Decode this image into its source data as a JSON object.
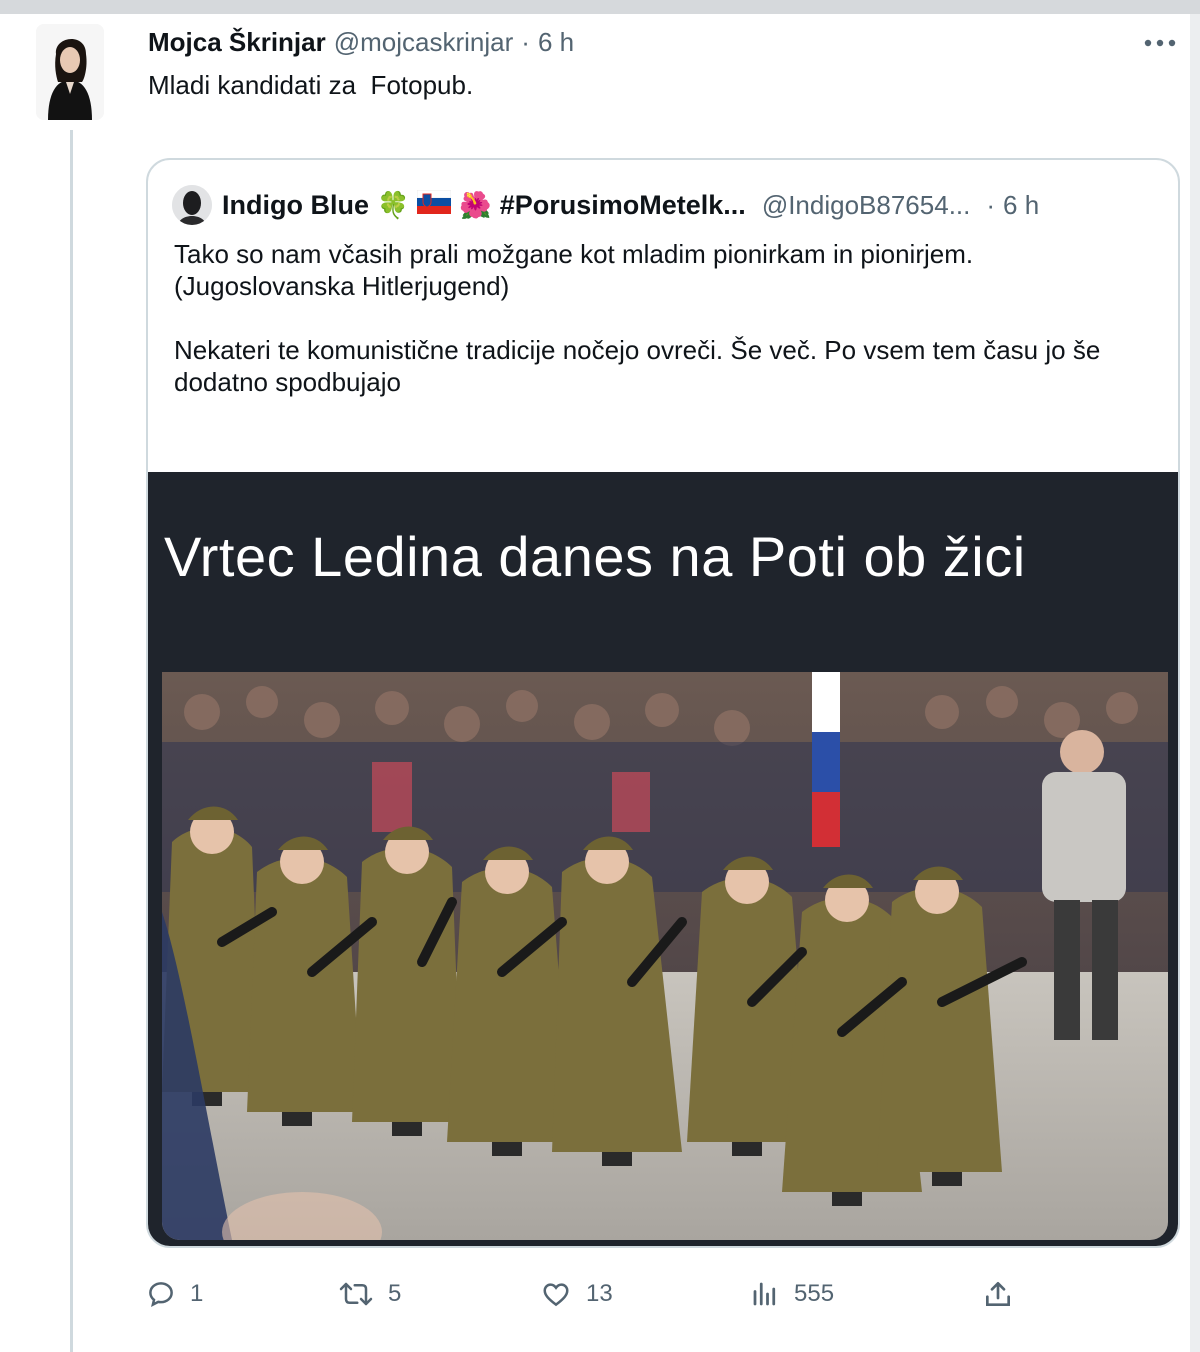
{
  "post": {
    "author_name": "Mojca Škrinjar",
    "handle": "@mojcaskrinjar",
    "separator": "·",
    "time": "6 h",
    "text": "Mladi kandidati za  Fotopub."
  },
  "quote": {
    "author_name": "Indigo Blue",
    "emojis": [
      "🍀",
      "🇸🇮",
      "🌺"
    ],
    "hashtag": "#PorusimoMetelk...",
    "handle": "@IndigoB87654...",
    "separator": "·",
    "time": "6 h",
    "text": "Tako so nam včasih prali možgane kot mladim pionirkam in pionirjem.\n(Jugoslovanska Hitlerjugend)\n\nNekateri te komunistične tradicije nočejo ovreči. Še več. Po vsem tem času jo še dodatno spodbujajo",
    "media_caption": "Vrtec Ledina danes na Poti ob žici"
  },
  "actions": {
    "reply_count": "1",
    "retweet_count": "5",
    "like_count": "13",
    "views_count": "555"
  },
  "icons": [
    "more-icon",
    "reply-icon",
    "retweet-icon",
    "like-icon",
    "views-icon",
    "share-icon"
  ],
  "colors": {
    "text": "#0f1419",
    "muted": "#536471",
    "border": "#cfd9de",
    "media_bg": "#1f242c"
  }
}
